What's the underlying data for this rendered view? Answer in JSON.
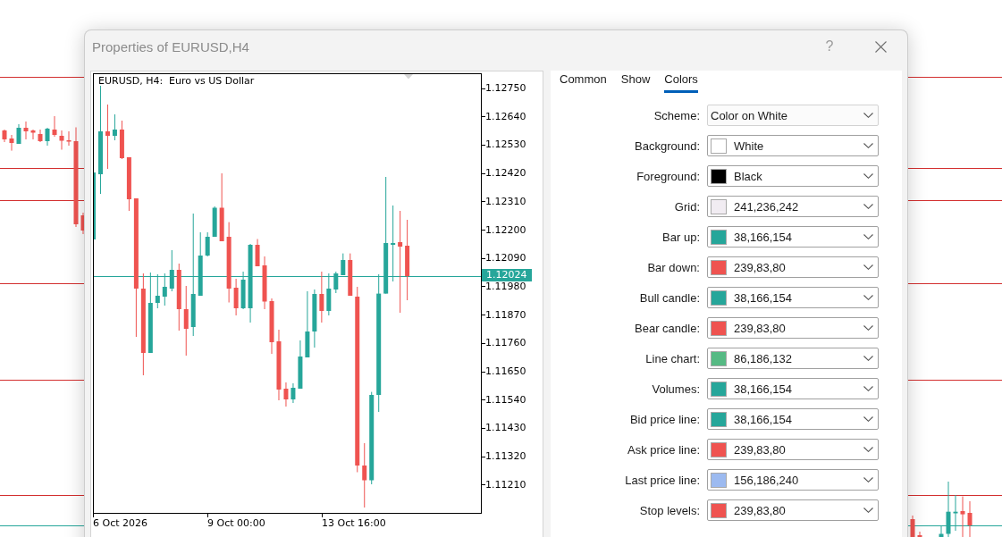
{
  "window": {
    "title": "Properties of EURUSD,H4",
    "help": "?"
  },
  "preview": {
    "title": "EURUSD, H4:  Euro vs US Dollar",
    "price_labels": [
      "1.12750",
      "1.12640",
      "1.12530",
      "1.12420",
      "1.12310",
      "1.12200",
      "1.12090",
      "1.11980",
      "1.11870",
      "1.11760",
      "1.11650",
      "1.11540",
      "1.11430",
      "1.11320",
      "1.11210"
    ],
    "current_price": "1.12024",
    "time_labels": [
      "6 Oct 2026",
      "9 Oct 00:00",
      "13 Oct 16:00"
    ]
  },
  "tabs": [
    {
      "label": "Common",
      "selected": false
    },
    {
      "label": "Show",
      "selected": false
    },
    {
      "label": "Colors",
      "selected": true
    }
  ],
  "colors": [
    {
      "kind": "scheme",
      "label": "Scheme:",
      "value": "Color on White"
    },
    {
      "kind": "color",
      "label": "Background:",
      "value": "White",
      "color": "#ffffff"
    },
    {
      "kind": "color",
      "label": "Foreground:",
      "value": "Black",
      "color": "#000000"
    },
    {
      "kind": "color",
      "label": "Grid:",
      "value": "241,236,242",
      "color": "#f1ecf2"
    },
    {
      "kind": "color",
      "label": "Bar up:",
      "value": "38,166,154",
      "color": "#26a69a"
    },
    {
      "kind": "color",
      "label": "Bar down:",
      "value": "239,83,80",
      "color": "#ef5350"
    },
    {
      "kind": "color",
      "label": "Bull candle:",
      "value": "38,166,154",
      "color": "#26a69a"
    },
    {
      "kind": "color",
      "label": "Bear candle:",
      "value": "239,83,80",
      "color": "#ef5350"
    },
    {
      "kind": "color",
      "label": "Line chart:",
      "value": "86,186,132",
      "color": "#56ba84"
    },
    {
      "kind": "color",
      "label": "Volumes:",
      "value": "38,166,154",
      "color": "#26a69a"
    },
    {
      "kind": "color",
      "label": "Bid price line:",
      "value": "38,166,154",
      "color": "#26a69a"
    },
    {
      "kind": "color",
      "label": "Ask price line:",
      "value": "239,83,80",
      "color": "#ef5350"
    },
    {
      "kind": "color",
      "label": "Last price line:",
      "value": "156,186,240",
      "color": "#9cbaf0"
    },
    {
      "kind": "color",
      "label": "Stop levels:",
      "value": "239,83,80",
      "color": "#ef5350"
    }
  ]
}
